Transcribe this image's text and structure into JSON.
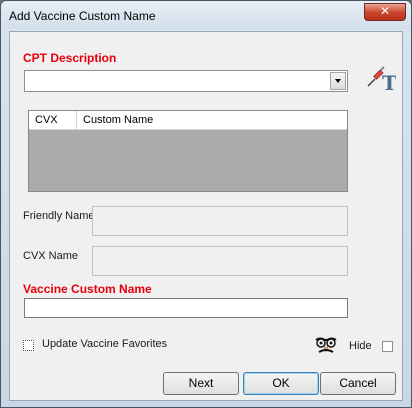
{
  "window": {
    "title": "Add Vaccine Custom Name",
    "close_glyph": "✕"
  },
  "cpt": {
    "label": "CPT Description",
    "value": ""
  },
  "grid": {
    "columns": [
      "CVX",
      "Custom Name"
    ],
    "rows": []
  },
  "friendly": {
    "label": "Friendly Name",
    "value": ""
  },
  "cvx": {
    "label": "CVX Name",
    "value": ""
  },
  "custom": {
    "label": "Vaccine Custom Name",
    "value": ""
  },
  "favorites": {
    "label": "Update Vaccine Favorites",
    "checked": false
  },
  "hide": {
    "label": "Hide",
    "checked": false
  },
  "buttons": {
    "next": "Next",
    "ok": "OK",
    "cancel": "Cancel"
  },
  "icons": {
    "tool": "syringe-text-tool-icon",
    "hide": "disguise-glasses-icon"
  },
  "colors": {
    "required_label": "#e8000b",
    "grid_empty": "#ababab"
  }
}
